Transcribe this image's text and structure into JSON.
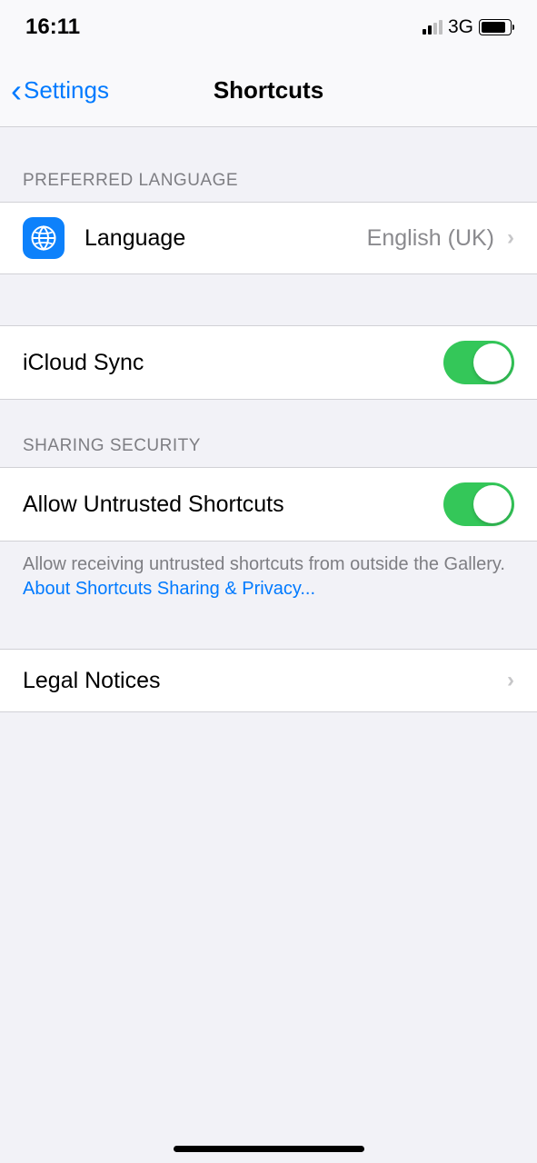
{
  "status": {
    "time": "16:11",
    "network": "3G"
  },
  "nav": {
    "back": "Settings",
    "title": "Shortcuts"
  },
  "sections": {
    "language": {
      "header": "PREFERRED LANGUAGE",
      "label": "Language",
      "value": "English (UK)"
    },
    "icloud": {
      "label": "iCloud Sync",
      "enabled": true
    },
    "security": {
      "header": "SHARING SECURITY",
      "label": "Allow Untrusted Shortcuts",
      "enabled": true,
      "footer_text": "Allow receiving untrusted shortcuts from outside the Gallery. ",
      "footer_link": "About Shortcuts Sharing & Privacy..."
    },
    "legal": {
      "label": "Legal Notices"
    }
  }
}
